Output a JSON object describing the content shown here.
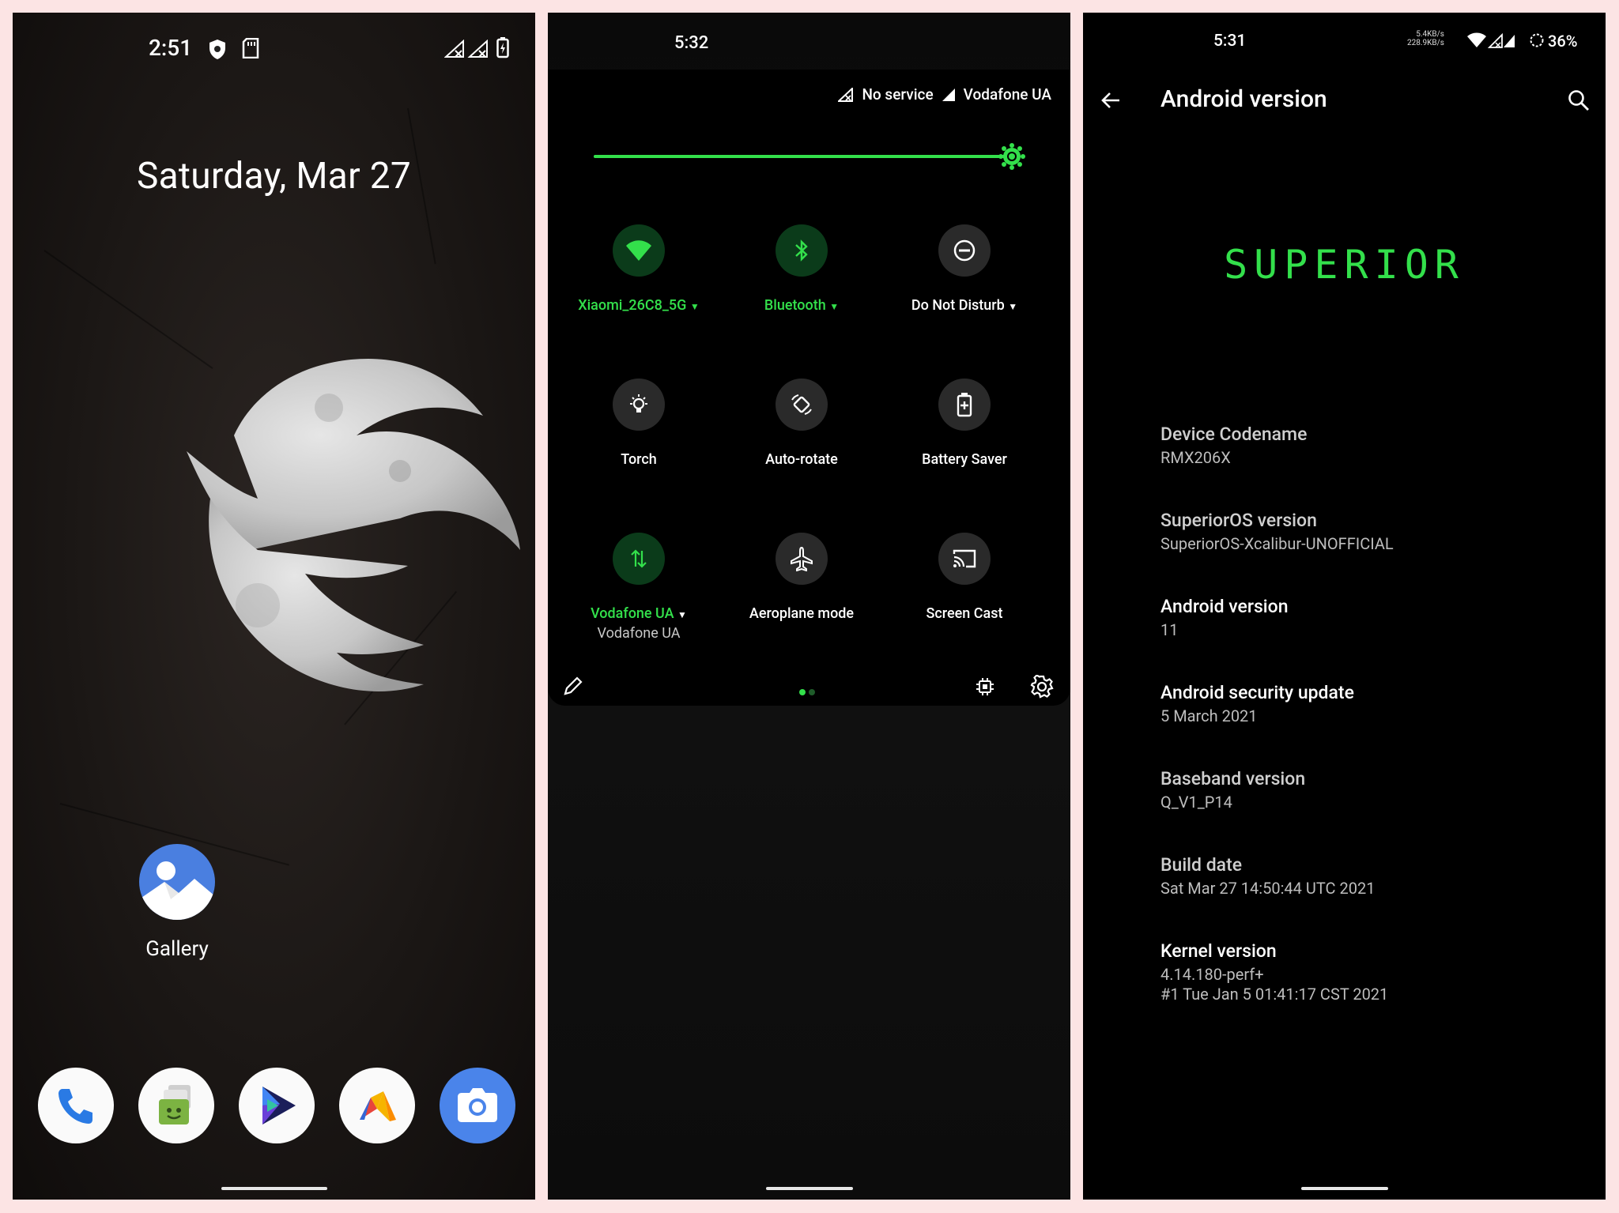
{
  "home": {
    "time": "2:51",
    "date": "Saturday, Mar 27",
    "gallery_label": "Gallery",
    "dock": [
      "phone-app",
      "messages-app",
      "play-app",
      "maps-app",
      "camera-app"
    ]
  },
  "quick_settings": {
    "time": "5:32",
    "no_service": "No service",
    "carrier": "Vodafone UA",
    "brightness_level": 0.98,
    "accent": "#33e04b",
    "tiles": [
      {
        "label": "Xiaomi_26C8_5G",
        "active": true,
        "expand": true
      },
      {
        "label": "Bluetooth",
        "active": true,
        "expand": true
      },
      {
        "label": "Do Not Disturb",
        "active": false,
        "expand": true
      },
      {
        "label": "Torch",
        "active": false
      },
      {
        "label": "Auto-rotate",
        "active": false
      },
      {
        "label": "Battery Saver",
        "active": false
      },
      {
        "label": "Vodafone UA",
        "sub": "Vodafone UA",
        "active": true,
        "expand": true
      },
      {
        "label": "Aeroplane mode",
        "active": false
      },
      {
        "label": "Screen Cast",
        "active": false
      }
    ]
  },
  "android_version": {
    "time": "5:31",
    "net_up": "5.4KB/s",
    "net_down": "228.9KB/s",
    "battery": "36%",
    "title": "Android version",
    "logo_text": "SUPERIOR",
    "items": [
      {
        "label": "Device Codename",
        "value": "RMX206X"
      },
      {
        "label": "SuperiorOS version",
        "value": "SuperiorOS-Xcalibur-UNOFFICIAL"
      },
      {
        "label": "Android version",
        "value": "11"
      },
      {
        "label": "Android security update",
        "value": "5 March 2021"
      },
      {
        "label": "Baseband version",
        "value": "Q_V1_P14"
      },
      {
        "label": "Build date",
        "value": "Sat Mar 27 14:50:44 UTC 2021"
      },
      {
        "label": "Kernel version",
        "value": "4.14.180-perf+",
        "value2": "#1 Tue Jan 5 01:41:17 CST 2021"
      }
    ]
  }
}
